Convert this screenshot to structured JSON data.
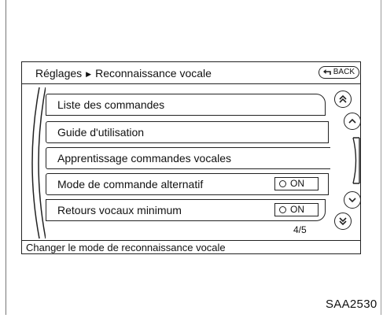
{
  "header": {
    "breadcrumb_parent": "Réglages",
    "breadcrumb_separator": "▶",
    "breadcrumb_current": "Reconnaissance vocale",
    "back_label": "BACK"
  },
  "menu": {
    "items": [
      {
        "label": "Liste des commandes"
      },
      {
        "label": "Guide d'utilisation"
      },
      {
        "label": "Apprentissage commandes vocales"
      },
      {
        "label": "Mode de commande alternatif",
        "toggle": "ON"
      },
      {
        "label": "Retours vocaux minimum",
        "toggle": "ON"
      }
    ],
    "page_indicator": "4/5"
  },
  "status": {
    "text": "Changer le mode de reconnaissance vocale"
  },
  "caption": "SAA2530",
  "icons": {
    "page_up": "double-chevron-up-icon",
    "line_up": "chevron-up-icon",
    "line_down": "chevron-down-icon",
    "page_down": "double-chevron-down-icon",
    "back": "back-arrow-icon"
  }
}
